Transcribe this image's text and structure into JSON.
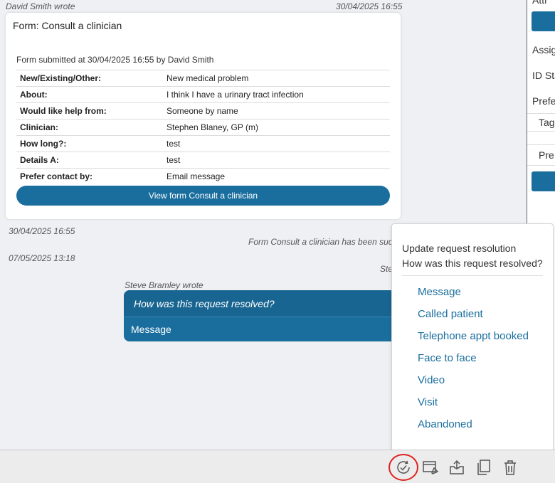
{
  "thread": {
    "form_message": {
      "author": "David Smith wrote",
      "timestamp": "30/04/2025 16:55",
      "title": "Form: Consult a clinician",
      "submitted": "Form submitted at 30/04/2025 16:55 by David Smith",
      "rows": [
        {
          "key": "New/Existing/Other:",
          "value": "New medical problem"
        },
        {
          "key": "About:",
          "value": "I think I have a urinary tract infection"
        },
        {
          "key": "Would like help from:",
          "value": "Someone by name"
        },
        {
          "key": "Clinician:",
          "value": "Stephen Blaney, GP (m)"
        },
        {
          "key": "How long?:",
          "value": "test"
        },
        {
          "key": "Details A:",
          "value": "test"
        },
        {
          "key": "Prefer contact by:",
          "value": "Email message"
        }
      ],
      "view_button": "View form Consult a clinician"
    },
    "system_1": {
      "timestamp": "30/04/2025 16:55",
      "text": "Form Consult a clinician has been suc"
    },
    "system_2": {
      "timestamp": "07/05/2025 13:18",
      "text": "Ste"
    },
    "reply": {
      "author": "Steve Bramley wrote",
      "question": "How was this request resolved?",
      "answer": "Message"
    }
  },
  "right_panel": {
    "lines": [
      "Attr",
      "Assig",
      "ID Sta",
      "Prefe",
      "Tag",
      "Pre"
    ]
  },
  "popover": {
    "title": "Update request resolution",
    "subtitle": "How was this request resolved?",
    "options": [
      "Message",
      "Called patient",
      "Telephone appt booked",
      "Face to face",
      "Video",
      "Visit",
      "Abandoned"
    ]
  },
  "toolbar": {
    "icons": [
      "resolve-check-icon",
      "window-edit-icon",
      "export-icon",
      "copy-icon",
      "trash-icon"
    ]
  },
  "colors": {
    "accent": "#1a6e9e",
    "highlight": "#e02020"
  }
}
